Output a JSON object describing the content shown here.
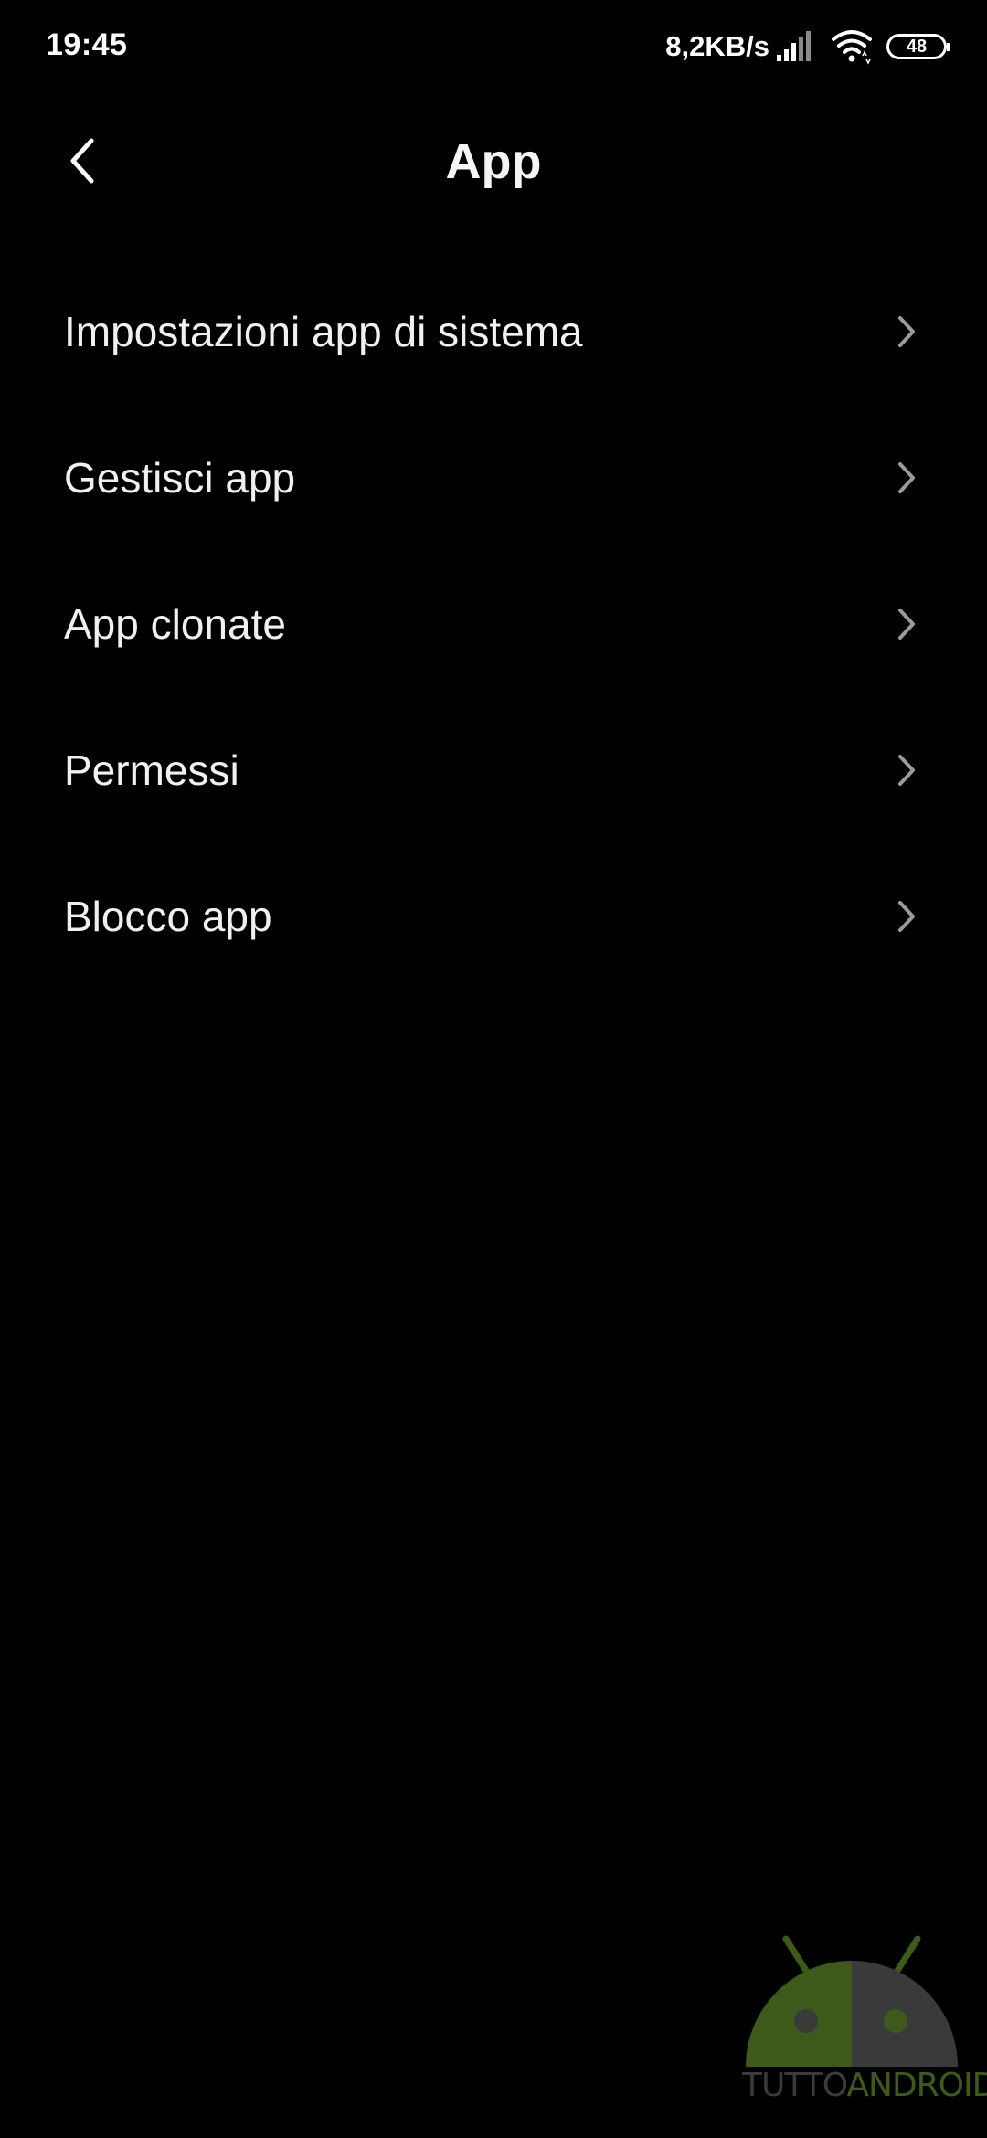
{
  "status_bar": {
    "time": "19:45",
    "net_speed": "8,2KB/s",
    "battery_level": "48"
  },
  "header": {
    "title": "App"
  },
  "menu": {
    "items": [
      {
        "label": "Impostazioni app di sistema"
      },
      {
        "label": "Gestisci app"
      },
      {
        "label": "App clonate"
      },
      {
        "label": "Permessi"
      },
      {
        "label": "Blocco app"
      }
    ]
  },
  "watermark": {
    "part1": "TUTTO",
    "part2": "ANDROID"
  },
  "colors": {
    "background": "#000000",
    "text": "#f0f0f0",
    "chevron": "#9a9a9a",
    "watermark_green": "#3d5a1a"
  }
}
